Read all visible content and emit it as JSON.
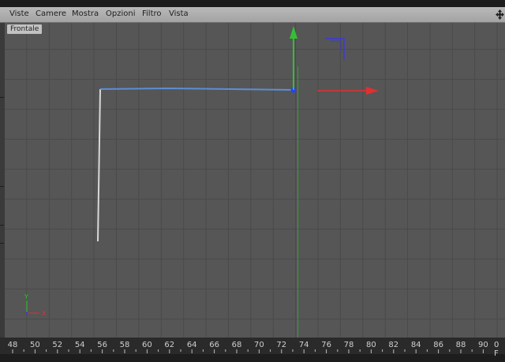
{
  "menubar": {
    "items": [
      "Viste",
      "Camere",
      "Mostra",
      "Opzioni",
      "Filtro",
      "Vista"
    ]
  },
  "viewport": {
    "label": "Frontale",
    "axis_y_label": "Y",
    "axis_x_label": "X",
    "colors": {
      "background": "#565656",
      "grid": "#4a4a4a",
      "spline_selected": "#5b8fd6",
      "spline": "#d8d8d8",
      "axis_x": "#e03030",
      "axis_y": "#33c033",
      "axis_z": "#3030d0"
    }
  },
  "timeline": {
    "ticks": [
      "48",
      "50",
      "52",
      "54",
      "56",
      "58",
      "60",
      "62",
      "64",
      "66",
      "68",
      "70",
      "72",
      "74",
      "76",
      "78",
      "80",
      "82",
      "84",
      "86",
      "88",
      "90"
    ],
    "current_frame": "0 F"
  }
}
